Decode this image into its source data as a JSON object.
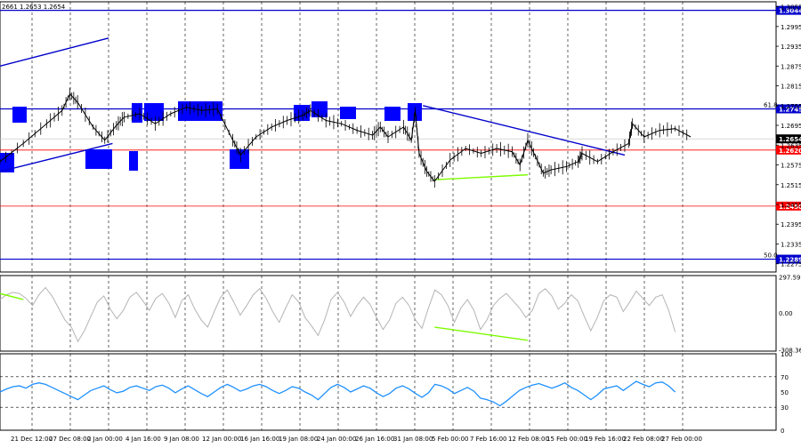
{
  "header": {
    "ohlc_text": "2661 1.2653 1.2654"
  },
  "colors": {
    "background": "#ffffff",
    "grid": "#000000",
    "level_blue": "#0000cc",
    "level_red": "#ff0000",
    "zone_blue": "#0000ff",
    "divergence_green": "#7cfc00",
    "cci_line": "#b4b4b4",
    "rsi_line": "#1e90ff",
    "price_box": "#000000"
  },
  "chart_data": [
    {
      "type": "line",
      "subtype": "candlestick",
      "panel": "price",
      "y_ticks": [
        "1.3055",
        "1.2995",
        "1.2935",
        "1.2875",
        "1.2815",
        "1.2755",
        "1.2695",
        "1.2635",
        "1.2575",
        "1.2515",
        "1.2455",
        "1.2395",
        "1.2335",
        "1.2275"
      ],
      "ylim": [
        1.225,
        1.307
      ],
      "levels": [
        {
          "value": 1.3044,
          "label": "1.3044",
          "color": "blue"
        },
        {
          "value": 1.2745,
          "label": "1.2745",
          "fibo_label": "61.8",
          "color": "blue"
        },
        {
          "value": 1.2654,
          "label": "1.2654",
          "current_price": true
        },
        {
          "value": 1.262,
          "label": "1.2620",
          "color": "red"
        },
        {
          "value": 1.245,
          "label": "1.2450",
          "color": "red"
        },
        {
          "value": 1.2289,
          "label": "1.2289",
          "fibo_label": "50.0",
          "color": "blue"
        }
      ],
      "price_path": [
        [
          0,
          1.2585
        ],
        [
          0.03,
          1.264
        ],
        [
          0.06,
          1.27
        ],
        [
          0.08,
          1.274
        ],
        [
          0.09,
          1.279
        ],
        [
          0.1,
          1.2765
        ],
        [
          0.12,
          1.269
        ],
        [
          0.135,
          1.265
        ],
        [
          0.15,
          1.2695
        ],
        [
          0.16,
          1.272
        ],
        [
          0.18,
          1.273
        ],
        [
          0.2,
          1.27
        ],
        [
          0.22,
          1.273
        ],
        [
          0.24,
          1.275
        ],
        [
          0.26,
          1.274
        ],
        [
          0.28,
          1.2745
        ],
        [
          0.3,
          1.265
        ],
        [
          0.31,
          1.2605
        ],
        [
          0.33,
          1.266
        ],
        [
          0.35,
          1.269
        ],
        [
          0.37,
          1.271
        ],
        [
          0.39,
          1.2725
        ],
        [
          0.4,
          1.274
        ],
        [
          0.42,
          1.271
        ],
        [
          0.44,
          1.27
        ],
        [
          0.46,
          1.268
        ],
        [
          0.48,
          1.2665
        ],
        [
          0.49,
          1.269
        ],
        [
          0.5,
          1.266
        ],
        [
          0.52,
          1.269
        ],
        [
          0.53,
          1.265
        ],
        [
          0.535,
          1.274
        ],
        [
          0.54,
          1.261
        ],
        [
          0.55,
          1.2555
        ],
        [
          0.56,
          1.2525
        ],
        [
          0.58,
          1.259
        ],
        [
          0.6,
          1.2625
        ],
        [
          0.62,
          1.261
        ],
        [
          0.64,
          1.2625
        ],
        [
          0.66,
          1.2615
        ],
        [
          0.67,
          1.2575
        ],
        [
          0.68,
          1.265
        ],
        [
          0.69,
          1.26
        ],
        [
          0.7,
          1.255
        ],
        [
          0.71,
          1.256
        ],
        [
          0.73,
          1.257
        ],
        [
          0.745,
          1.2585
        ],
        [
          0.75,
          1.261
        ],
        [
          0.77,
          1.2585
        ],
        [
          0.79,
          1.2615
        ],
        [
          0.81,
          1.264
        ],
        [
          0.815,
          1.27
        ],
        [
          0.83,
          1.266
        ],
        [
          0.85,
          1.268
        ],
        [
          0.87,
          1.2685
        ],
        [
          0.89,
          1.266
        ]
      ],
      "trend_lines": [
        {
          "name": "upper channel",
          "points": [
            [
              0,
              1.2875
            ],
            [
              0.14,
              1.296
            ]
          ],
          "color": "blue"
        },
        {
          "name": "lower channel",
          "points": [
            [
              0,
              1.2555
            ],
            [
              0.145,
              1.264
            ]
          ],
          "color": "blue"
        },
        {
          "name": "descending trend line",
          "points": [
            [
              0.545,
              1.2755
            ],
            [
              0.805,
              1.2605
            ]
          ],
          "color": "blue"
        },
        {
          "name": "support divergence",
          "points": [
            [
              0.56,
              1.253
            ],
            [
              0.68,
              1.2545
            ]
          ],
          "color": "green"
        }
      ]
    },
    {
      "type": "line",
      "panel": "cci",
      "y_ticks": [
        "297.5966",
        "0.00",
        "-308.3640"
      ],
      "ylim": [
        -320,
        310
      ],
      "series": [
        {
          "values": [
            110,
            150,
            170,
            160,
            120,
            60,
            150,
            210,
            140,
            40,
            -60,
            -120,
            -240,
            -150,
            -30,
            90,
            140,
            30,
            -50,
            20,
            130,
            170,
            100,
            20,
            120,
            160,
            80,
            -40,
            100,
            150,
            30,
            -60,
            -120,
            10,
            130,
            190,
            90,
            -20,
            60,
            150,
            200,
            120,
            10,
            -80,
            40,
            150,
            90,
            -40,
            -110,
            -190,
            -60,
            110,
            170,
            90,
            -30,
            60,
            130,
            70,
            -40,
            -140,
            -60,
            80,
            130,
            60,
            -60,
            -130,
            40,
            190,
            150,
            60,
            -80,
            40,
            110,
            20,
            -140,
            -60,
            60,
            120,
            160,
            100,
            40,
            -40,
            20,
            160,
            200,
            140,
            30,
            80,
            150,
            100,
            -30,
            -150,
            -40,
            100,
            150,
            130,
            10,
            90,
            180,
            120,
            60,
            130,
            150,
            20,
            -160
          ]
        }
      ],
      "divergence_lines": [
        {
          "points": [
            [
              0,
              160
            ],
            [
              0.03,
              110
            ]
          ]
        },
        {
          "points": [
            [
              0.56,
              -120
            ],
            [
              0.68,
              -230
            ]
          ]
        }
      ]
    },
    {
      "type": "line",
      "panel": "rsi",
      "y_ticks": [
        "100",
        "70",
        "50",
        "30",
        "0"
      ],
      "ylim": [
        0,
        100
      ],
      "series": [
        {
          "values": [
            50,
            54,
            57,
            58,
            55,
            60,
            62,
            60,
            56,
            52,
            48,
            44,
            40,
            46,
            52,
            55,
            58,
            53,
            49,
            51,
            56,
            58,
            55,
            52,
            57,
            59,
            55,
            49,
            54,
            58,
            53,
            48,
            44,
            50,
            56,
            60,
            56,
            51,
            54,
            58,
            60,
            57,
            52,
            48,
            52,
            57,
            55,
            50,
            46,
            40,
            48,
            56,
            60,
            56,
            50,
            54,
            58,
            55,
            49,
            44,
            48,
            55,
            58,
            54,
            48,
            43,
            49,
            60,
            58,
            54,
            48,
            52,
            56,
            51,
            42,
            40,
            37,
            32,
            38,
            45,
            52,
            56,
            59,
            61,
            58,
            55,
            58,
            62,
            56,
            52,
            46,
            40,
            46,
            54,
            56,
            58,
            52,
            58,
            64,
            60,
            57,
            62,
            63,
            58,
            50
          ]
        }
      ]
    }
  ],
  "date_axis": [
    "21 Dec 12:00",
    "27 Dec 08:00",
    "2 Jan 00:00",
    "4 Jan 16:00",
    "9 Jan 08:00",
    "12 Jan 00:00",
    "16 Jan 16:00",
    "19 Jan 08:00",
    "24 Jan 00:00",
    "26 Jan 16:00",
    "31 Jan 08:00",
    "5 Feb 00:00",
    "7 Feb 16:00",
    "12 Feb 08:00",
    "15 Feb 00:00",
    "19 Feb 16:00",
    "22 Feb 08:00",
    "27 Feb 00:00"
  ]
}
